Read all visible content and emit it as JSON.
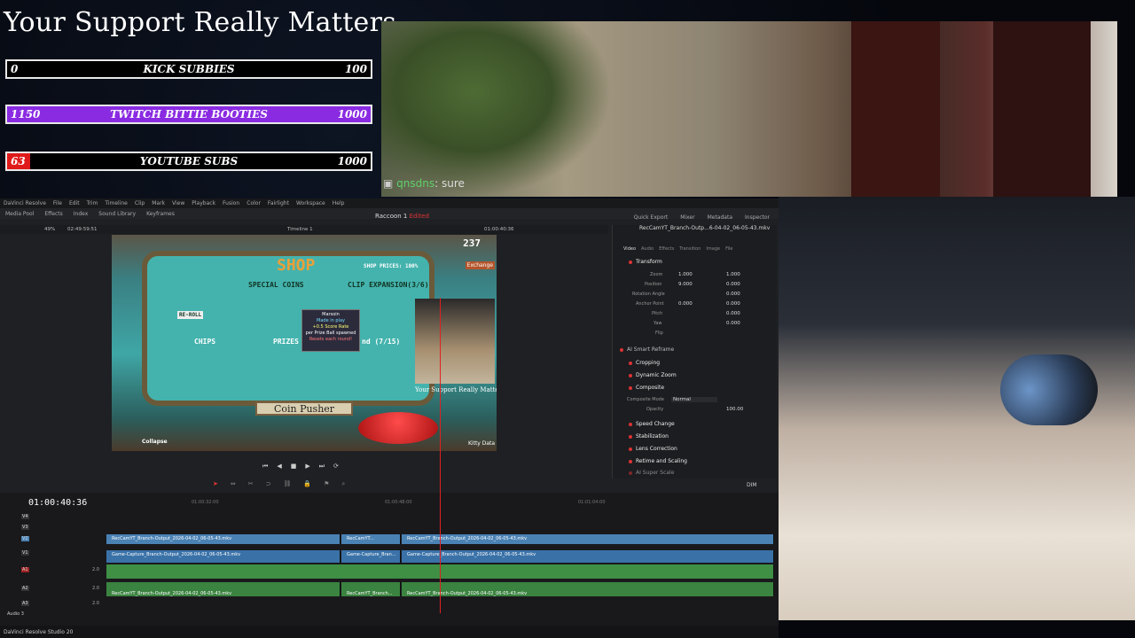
{
  "overlay": {
    "title": "Your Support Really Matters",
    "goals": [
      {
        "current": "0",
        "label": "KICK SUBBIES",
        "target": "100",
        "fill_color": "#000000",
        "fraction": 0.0
      },
      {
        "current": "1150",
        "label": "TWITCH BITTIE BOOTIES",
        "target": "1000",
        "fill_color": "#8a2be2",
        "fraction": 1.0
      },
      {
        "current": "63",
        "label": "YOUTUBE SUBS",
        "target": "1000",
        "fill_color": "#e01a1a",
        "fraction": 0.063
      }
    ],
    "chat": {
      "user": "qnsdns",
      "message": ": sure"
    }
  },
  "resolve": {
    "menu": [
      "DaVinci Resolve",
      "File",
      "Edit",
      "Trim",
      "Timeline",
      "Clip",
      "Mark",
      "View",
      "Playback",
      "Fusion",
      "Color",
      "Fairlight",
      "Workspace",
      "Help"
    ],
    "toolbar_left": [
      "Media Pool",
      "Effects",
      "Index",
      "Sound Library",
      "Keyframes"
    ],
    "project_title": "Raccoon 1",
    "project_status": "Edited",
    "toolbar_right": [
      "Quick Export",
      "Mixer",
      "Metadata",
      "Inspector"
    ],
    "viewer_bar": {
      "zoom": "49%",
      "timecode_left": "02:49:59:51",
      "timeline": "Timeline 1",
      "timecode_right": "01:00:40:36",
      "clip_name": "RecCamYT_Branch-Outp...6-04-02_06-05-43.mkv"
    },
    "inspector": {
      "tabs": [
        "Video",
        "Audio",
        "Effects",
        "Transition",
        "Image",
        "File"
      ],
      "transform_title": "Transform",
      "props": [
        {
          "name": "Zoom",
          "x": "1.000",
          "y": "1.000"
        },
        {
          "name": "Position",
          "x": "9.000",
          "y": "0.000"
        },
        {
          "name": "Rotation Angle",
          "x": "",
          "y": "0.000"
        },
        {
          "name": "Anchor Point",
          "x": "0.000",
          "y": "0.000"
        },
        {
          "name": "Pitch",
          "x": "",
          "y": "0.000"
        },
        {
          "name": "Yaw",
          "x": "",
          "y": "0.000"
        },
        {
          "name": "Flip",
          "x": "",
          "y": ""
        }
      ],
      "sections": [
        "AI Smart Reframe",
        "Cropping",
        "Dynamic Zoom",
        "Composite",
        "Speed Change",
        "Stabilization",
        "Lens Correction",
        "Retime and Scaling",
        "AI Super Scale"
      ],
      "composite_mode_label": "Composite Mode",
      "composite_mode_value": "Normal",
      "opacity_label": "Opacity",
      "opacity_value": "100.00"
    },
    "timeline": {
      "timecode": "01:00:40:36",
      "ruler": [
        "01:00:32:00",
        "01:00:48:00",
        "01:01:04:00"
      ],
      "tracks": [
        "V4",
        "V3",
        "V2",
        "V1",
        "A1",
        "A2",
        "A3"
      ],
      "clips_v2": [
        "RecCamYT_Branch-Output_2026-04-02_06-05-43.mkv",
        "RecCamYT...",
        "RecCamYT_Branch-Output_2026-04-02_06-05-43.mkv"
      ],
      "clips_v1": [
        "Game-Capture_Branch-Output_2026-04-02_06-05-43.mkv",
        "Game-Capture_Bran...",
        "Game-Capture_Branch-Output_2026-04-02_06-05-43.mkv"
      ],
      "clips_a2": [
        "RecCamYT_Branch-Output_2026-04-02_06-05-43.mkv",
        "RecCamYT_Branch...",
        "RecCamYT_Branch-Output_2026-04-02_06-05-43.mkv"
      ],
      "audio_level": "2.0",
      "dim_label": "DIM",
      "audio3_label": "Audio 3"
    },
    "footer": "DaVinci Resolve Studio 20"
  },
  "game": {
    "shop": "SHOP",
    "shop_prices": "SHOP PRICES: 100%",
    "score": "237",
    "exchange": "Exchange",
    "special_coins": "SPECIAL COINS",
    "clip_expansion": "CLIP EXPANSION(3/6)",
    "chips": "CHIPS",
    "prizes": "PRIZES",
    "reroll": "RE-ROLL",
    "tooltip_title": "Marsoin",
    "tooltip_line1": "Made in play",
    "tooltip_line2": "+0.5 Score Rate",
    "tooltip_line3": "per Prize Ball spawned",
    "tooltip_line4": "Resets each round!",
    "round_text": "nd (7/15)",
    "name": "Coin Pusher",
    "collapse": "Collapse",
    "kitty": "Kitty Data",
    "webcam_caption": "Your Support Really Matters"
  }
}
